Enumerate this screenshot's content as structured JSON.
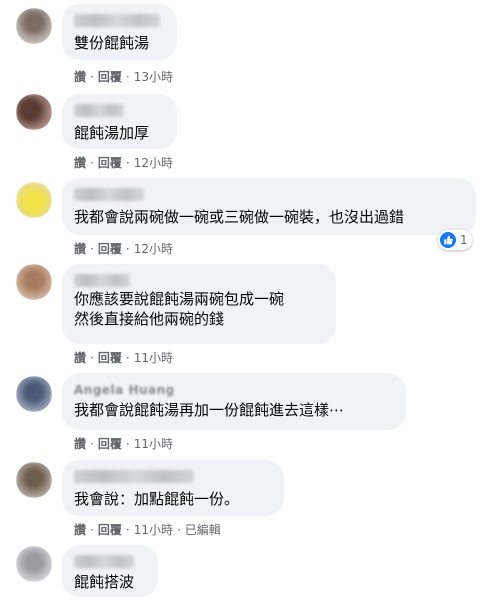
{
  "actions": {
    "like": "讚",
    "reply": "回覆",
    "edited": "已編輯",
    "separator": "·"
  },
  "comments": [
    {
      "text": "雙份餛飩湯",
      "time": "13小時"
    },
    {
      "text": "餛飩湯加厚",
      "time": "12小時"
    },
    {
      "text": "我都會說兩碗做一碗或三碗做一碗裝，也沒出過錯",
      "time": "12小時",
      "reaction_count": "1",
      "reaction_icon": "like-icon"
    },
    {
      "line1": "你應該要說餛飩湯兩碗包成一碗",
      "line2": "然後直接給他兩碗的錢",
      "time": "11小時"
    },
    {
      "author": "Angela Huang",
      "text": "我都會說餛飩湯再加一份餛飩進去這樣⋯",
      "time": "11小時"
    },
    {
      "text": "我會說：加點餛飩一份。",
      "time": "11小時",
      "edited": true
    },
    {
      "text": "餛飩搭波"
    }
  ],
  "colors": {
    "bubble": "#f0f2f5",
    "meta": "#65676b",
    "like_blue": "#1877f2"
  }
}
